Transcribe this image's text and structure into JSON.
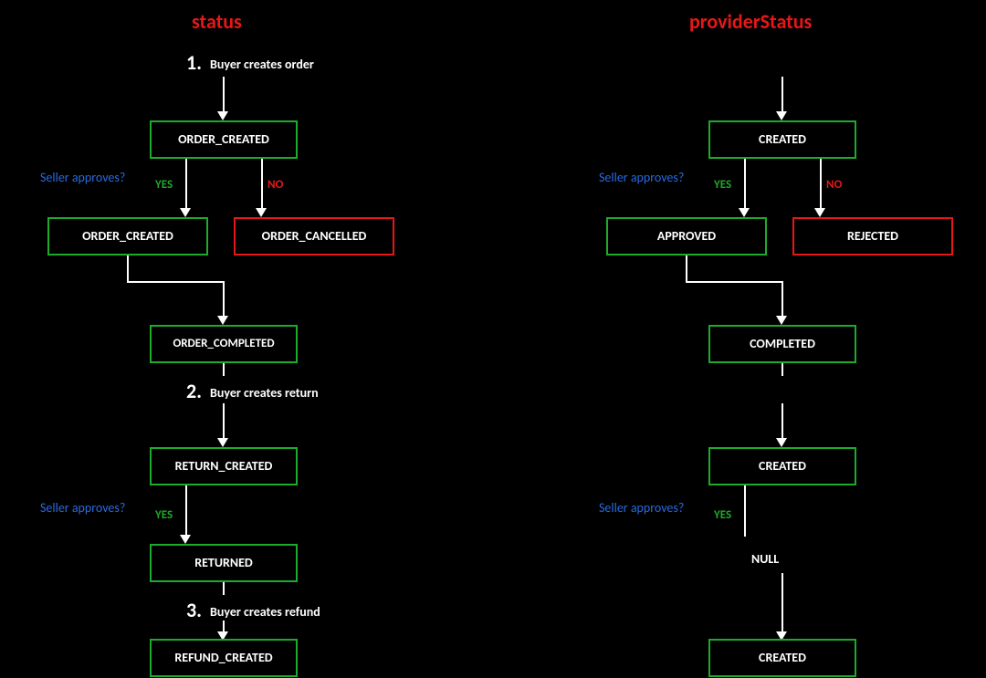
{
  "titles": {
    "left": "status",
    "right": "providerStatus"
  },
  "steps": {
    "s1": {
      "num": "1.",
      "text": "Buyer creates order"
    },
    "s2": {
      "num": "2.",
      "text": "Buyer creates return"
    },
    "s3": {
      "num": "3.",
      "text": "Buyer creates refund"
    }
  },
  "prompts": {
    "seller_approves": "Seller approves?",
    "yes": "YES",
    "no": "NO"
  },
  "left": {
    "b1": "ORDER_CREATED",
    "b_yes": "ORDER_CREATED",
    "b_no": "ORDER_CANCELLED",
    "b2": "ORDER_COMPLETED",
    "b3": "RETURN_CREATED",
    "b4": "RETURNED",
    "b5": "REFUND_CREATED"
  },
  "right": {
    "b1": "CREATED",
    "b_yes": "APPROVED",
    "b_no": "REJECTED",
    "b2": "COMPLETED",
    "b3": "CREATED",
    "b4": "NULL",
    "b5": "CREATED"
  }
}
